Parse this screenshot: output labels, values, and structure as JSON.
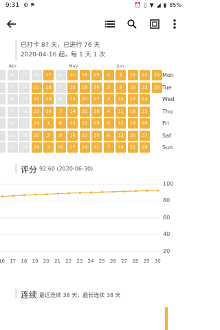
{
  "status": {
    "time": "9:31",
    "battery": "85%"
  },
  "toolbar": {
    "back": "back-arrow-icon",
    "actions": [
      "list-icon",
      "search-icon",
      "widget-icon",
      "more-vert-icon"
    ]
  },
  "summary": {
    "line1": "已打卡 87 天，已进行 76 天",
    "line2": "2020-04-16 起，每 1 天 1 次"
  },
  "calendar": {
    "months": [
      "Apr",
      "May",
      "Jun"
    ],
    "weekdays": [
      "Mon",
      "Tue",
      "Wed",
      "Thu",
      "Fri",
      "Sat",
      "Sun"
    ],
    "columns": [
      [
        {
          "d": "",
          "s": "miss"
        },
        {
          "d": "",
          "s": "miss"
        },
        {
          "d": "",
          "s": "miss"
        },
        {
          "d": "",
          "s": "miss"
        },
        {
          "d": "",
          "s": "miss"
        },
        {
          "d": "",
          "s": "miss"
        },
        {
          "d": "",
          "s": "miss"
        }
      ],
      [
        {
          "d": "6",
          "s": "miss"
        },
        {
          "d": "7",
          "s": "miss"
        },
        {
          "d": "8",
          "s": "miss"
        },
        {
          "d": "9",
          "s": "miss"
        },
        {
          "d": "10",
          "s": "miss"
        },
        {
          "d": "11",
          "s": "miss"
        },
        {
          "d": "12",
          "s": "miss"
        }
      ],
      [
        {
          "d": "13",
          "s": "miss"
        },
        {
          "d": "14",
          "s": "miss"
        },
        {
          "d": "15",
          "s": "miss"
        },
        {
          "d": "16",
          "s": "miss"
        },
        {
          "d": "17",
          "s": "miss"
        },
        {
          "d": "18",
          "s": "miss"
        },
        {
          "d": "19",
          "s": "miss"
        }
      ],
      [
        {
          "d": "20",
          "s": "miss"
        },
        {
          "d": "21",
          "s": "done"
        },
        {
          "d": "22",
          "s": "done"
        },
        {
          "d": "23",
          "s": "done"
        },
        {
          "d": "24",
          "s": "done"
        },
        {
          "d": "25",
          "s": "done"
        },
        {
          "d": "26",
          "s": "done"
        }
      ],
      [
        {
          "d": "27",
          "s": "done"
        },
        {
          "d": "28",
          "s": "done"
        },
        {
          "d": "29",
          "s": "done"
        },
        {
          "d": "30",
          "s": "done"
        },
        {
          "d": "1",
          "s": "done"
        },
        {
          "d": "2",
          "s": "done"
        },
        {
          "d": "3",
          "s": "done"
        }
      ],
      [
        {
          "d": "4",
          "s": "miss"
        },
        {
          "d": "5",
          "s": "miss"
        },
        {
          "d": "6",
          "s": "miss"
        },
        {
          "d": "7",
          "s": "done"
        },
        {
          "d": "8",
          "s": "done"
        },
        {
          "d": "9",
          "s": "done"
        },
        {
          "d": "10",
          "s": "done"
        }
      ],
      [
        {
          "d": "11",
          "s": "done"
        },
        {
          "d": "12",
          "s": "done"
        },
        {
          "d": "13",
          "s": "done"
        },
        {
          "d": "14",
          "s": "done"
        },
        {
          "d": "15",
          "s": "done"
        },
        {
          "d": "16",
          "s": "done"
        },
        {
          "d": "17",
          "s": "done"
        }
      ],
      [
        {
          "d": "18",
          "s": "done"
        },
        {
          "d": "19",
          "s": "done"
        },
        {
          "d": "20",
          "s": "done"
        },
        {
          "d": "21",
          "s": "done"
        },
        {
          "d": "22",
          "s": "done"
        },
        {
          "d": "23",
          "s": "done"
        },
        {
          "d": "24",
          "s": "done"
        }
      ],
      [
        {
          "d": "25",
          "s": "done"
        },
        {
          "d": "26",
          "s": "done"
        },
        {
          "d": "27",
          "s": "done"
        },
        {
          "d": "28",
          "s": "done"
        },
        {
          "d": "29",
          "s": "done"
        },
        {
          "d": "30",
          "s": "done"
        },
        {
          "d": "31",
          "s": "done"
        }
      ],
      [
        {
          "d": "1",
          "s": "done"
        },
        {
          "d": "2",
          "s": "done"
        },
        {
          "d": "3",
          "s": "done"
        },
        {
          "d": "4",
          "s": "done"
        },
        {
          "d": "5",
          "s": "done"
        },
        {
          "d": "6",
          "s": "done"
        },
        {
          "d": "7",
          "s": "done"
        }
      ],
      [
        {
          "d": "8",
          "s": "done"
        },
        {
          "d": "9",
          "s": "done"
        },
        {
          "d": "10",
          "s": "done"
        },
        {
          "d": "11",
          "s": "done"
        },
        {
          "d": "12",
          "s": "done"
        },
        {
          "d": "13",
          "s": "done"
        },
        {
          "d": "14",
          "s": "done"
        }
      ],
      [
        {
          "d": "15",
          "s": "done"
        },
        {
          "d": "16",
          "s": "done"
        },
        {
          "d": "17",
          "s": "done"
        },
        {
          "d": "18",
          "s": "done"
        },
        {
          "d": "19",
          "s": "done"
        },
        {
          "d": "20",
          "s": "done"
        },
        {
          "d": "21",
          "s": "done"
        }
      ],
      [
        {
          "d": "22",
          "s": "done"
        },
        {
          "d": "23",
          "s": "done"
        },
        {
          "d": "24",
          "s": "done"
        },
        {
          "d": "25",
          "s": "done"
        },
        {
          "d": "26",
          "s": "done"
        },
        {
          "d": "27",
          "s": "done"
        },
        {
          "d": "28",
          "s": "done"
        }
      ],
      [
        {
          "d": "29",
          "s": "done"
        },
        {
          "d": "30",
          "s": "done"
        },
        {
          "d": "",
          "s": "none"
        },
        {
          "d": "",
          "s": "none"
        },
        {
          "d": "",
          "s": "none"
        },
        {
          "d": "",
          "s": "none"
        },
        {
          "d": "",
          "s": "none"
        }
      ]
    ],
    "month_label_cols": [
      1,
      6,
      10
    ]
  },
  "score": {
    "title": "评分",
    "value": "92.60 (2020-06-30)"
  },
  "chart_data": {
    "type": "line",
    "x": [
      "16",
      "17",
      "18",
      "19",
      "20",
      "21",
      "22",
      "23",
      "24",
      "25",
      "26",
      "27",
      "28",
      "29",
      "30"
    ],
    "values": [
      85.5,
      86.3,
      87.0,
      87.6,
      88.2,
      88.8,
      89.3,
      89.8,
      90.2,
      90.7,
      91.1,
      91.5,
      91.9,
      92.3,
      92.6
    ],
    "yticks": [
      100,
      80,
      60,
      40,
      20
    ],
    "ylim": [
      10,
      100
    ],
    "color": "#f0b23e",
    "grid": true
  },
  "streak": {
    "title": "连续",
    "subtitle": "最近连续 38 天，最长连续 38 天"
  }
}
